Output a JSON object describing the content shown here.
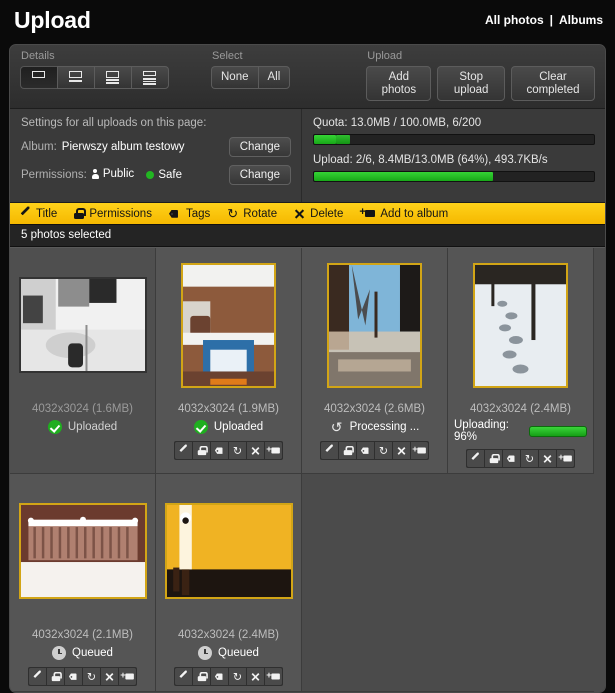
{
  "header": {
    "title": "Upload",
    "nav": {
      "all_photos": "All photos",
      "separator": "|",
      "albums": "Albums"
    }
  },
  "toolbar": {
    "details": {
      "label": "Details",
      "options": [
        "detail-level-1",
        "detail-level-2",
        "detail-level-3",
        "detail-level-4"
      ],
      "active_index": 0
    },
    "select": {
      "label": "Select",
      "none_label": "None",
      "all_label": "All"
    },
    "upload": {
      "label": "Upload",
      "add_photos_label": "Add photos",
      "stop_upload_label": "Stop upload",
      "clear_completed_label": "Clear completed"
    }
  },
  "settings": {
    "heading": "Settings for all uploads on this page:",
    "album_key": "Album:",
    "album_value": "Pierwszy album testowy",
    "album_change_label": "Change",
    "permissions_key": "Permissions:",
    "permission_public": "Public",
    "permission_safe": "Safe",
    "permissions_change_label": "Change"
  },
  "progress": {
    "quota_label": "Quota: 13.0MB / 100.0MB, 6/200",
    "quota_percent": 13,
    "quota_segment1_percent": 8,
    "quota_segment2_percent": 5,
    "upload_label": "Upload: 2/6, 8.4MB/13.0MB (64%), 493.7KB/s",
    "upload_percent": 64,
    "bar_color": "#22c422"
  },
  "actionbar": {
    "accent_color": "#ffcc00",
    "actions": [
      {
        "icon": "pencil-icon",
        "label": "Title"
      },
      {
        "icon": "lock-icon",
        "label": "Permissions"
      },
      {
        "icon": "tag-icon",
        "label": "Tags"
      },
      {
        "icon": "rotate-icon",
        "label": "Rotate"
      },
      {
        "icon": "close-icon",
        "label": "Delete"
      },
      {
        "icon": "add-to-album-icon",
        "label": "Add to album"
      }
    ]
  },
  "selection": {
    "status": "5 photos selected"
  },
  "card_icons": [
    {
      "icon": "pencil-icon",
      "name": "edit-title"
    },
    {
      "icon": "lock-icon",
      "name": "edit-permissions"
    },
    {
      "icon": "tag-icon",
      "name": "edit-tags"
    },
    {
      "icon": "rotate-icon",
      "name": "rotate"
    },
    {
      "icon": "close-icon",
      "name": "delete"
    },
    {
      "icon": "add-to-album-icon",
      "name": "add-to-album"
    }
  ],
  "photos": [
    {
      "dimensions": "4032x3024 (1.6MB)",
      "status": "Uploaded",
      "status_icon": "check-circle-icon",
      "selected": false,
      "dimmed": true,
      "has_icon_row": false,
      "orientation": "landscape",
      "thumb_kind": "bw-interior"
    },
    {
      "dimensions": "4032x3024 (1.9MB)",
      "status": "Uploaded",
      "status_icon": "check-circle-icon",
      "selected": true,
      "dimmed": false,
      "has_icon_row": true,
      "orientation": "portrait",
      "thumb_kind": "brick-snow"
    },
    {
      "dimensions": "4032x3024 (2.6MB)",
      "status": "Processing ...",
      "status_icon": "processing-icon",
      "selected": true,
      "dimmed": false,
      "has_icon_row": true,
      "orientation": "portrait",
      "thumb_kind": "street-dusk"
    },
    {
      "dimensions": "4032x3024 (2.4MB)",
      "status": "Uploading: 96%",
      "status_icon": "progress-bar",
      "progress_percent": 96,
      "selected": true,
      "dimmed": false,
      "has_icon_row": true,
      "orientation": "portrait",
      "thumb_kind": "snow-tracks"
    },
    {
      "dimensions": "4032x3024 (2.1MB)",
      "status": "Queued",
      "status_icon": "clock-icon",
      "selected": true,
      "dimmed": false,
      "has_icon_row": true,
      "orientation": "landscape",
      "thumb_kind": "brown-rail"
    },
    {
      "dimensions": "4032x3024 (2.4MB)",
      "status": "Queued",
      "status_icon": "clock-icon",
      "selected": true,
      "dimmed": false,
      "has_icon_row": true,
      "orientation": "landscape",
      "thumb_kind": "yellow-wall"
    }
  ]
}
